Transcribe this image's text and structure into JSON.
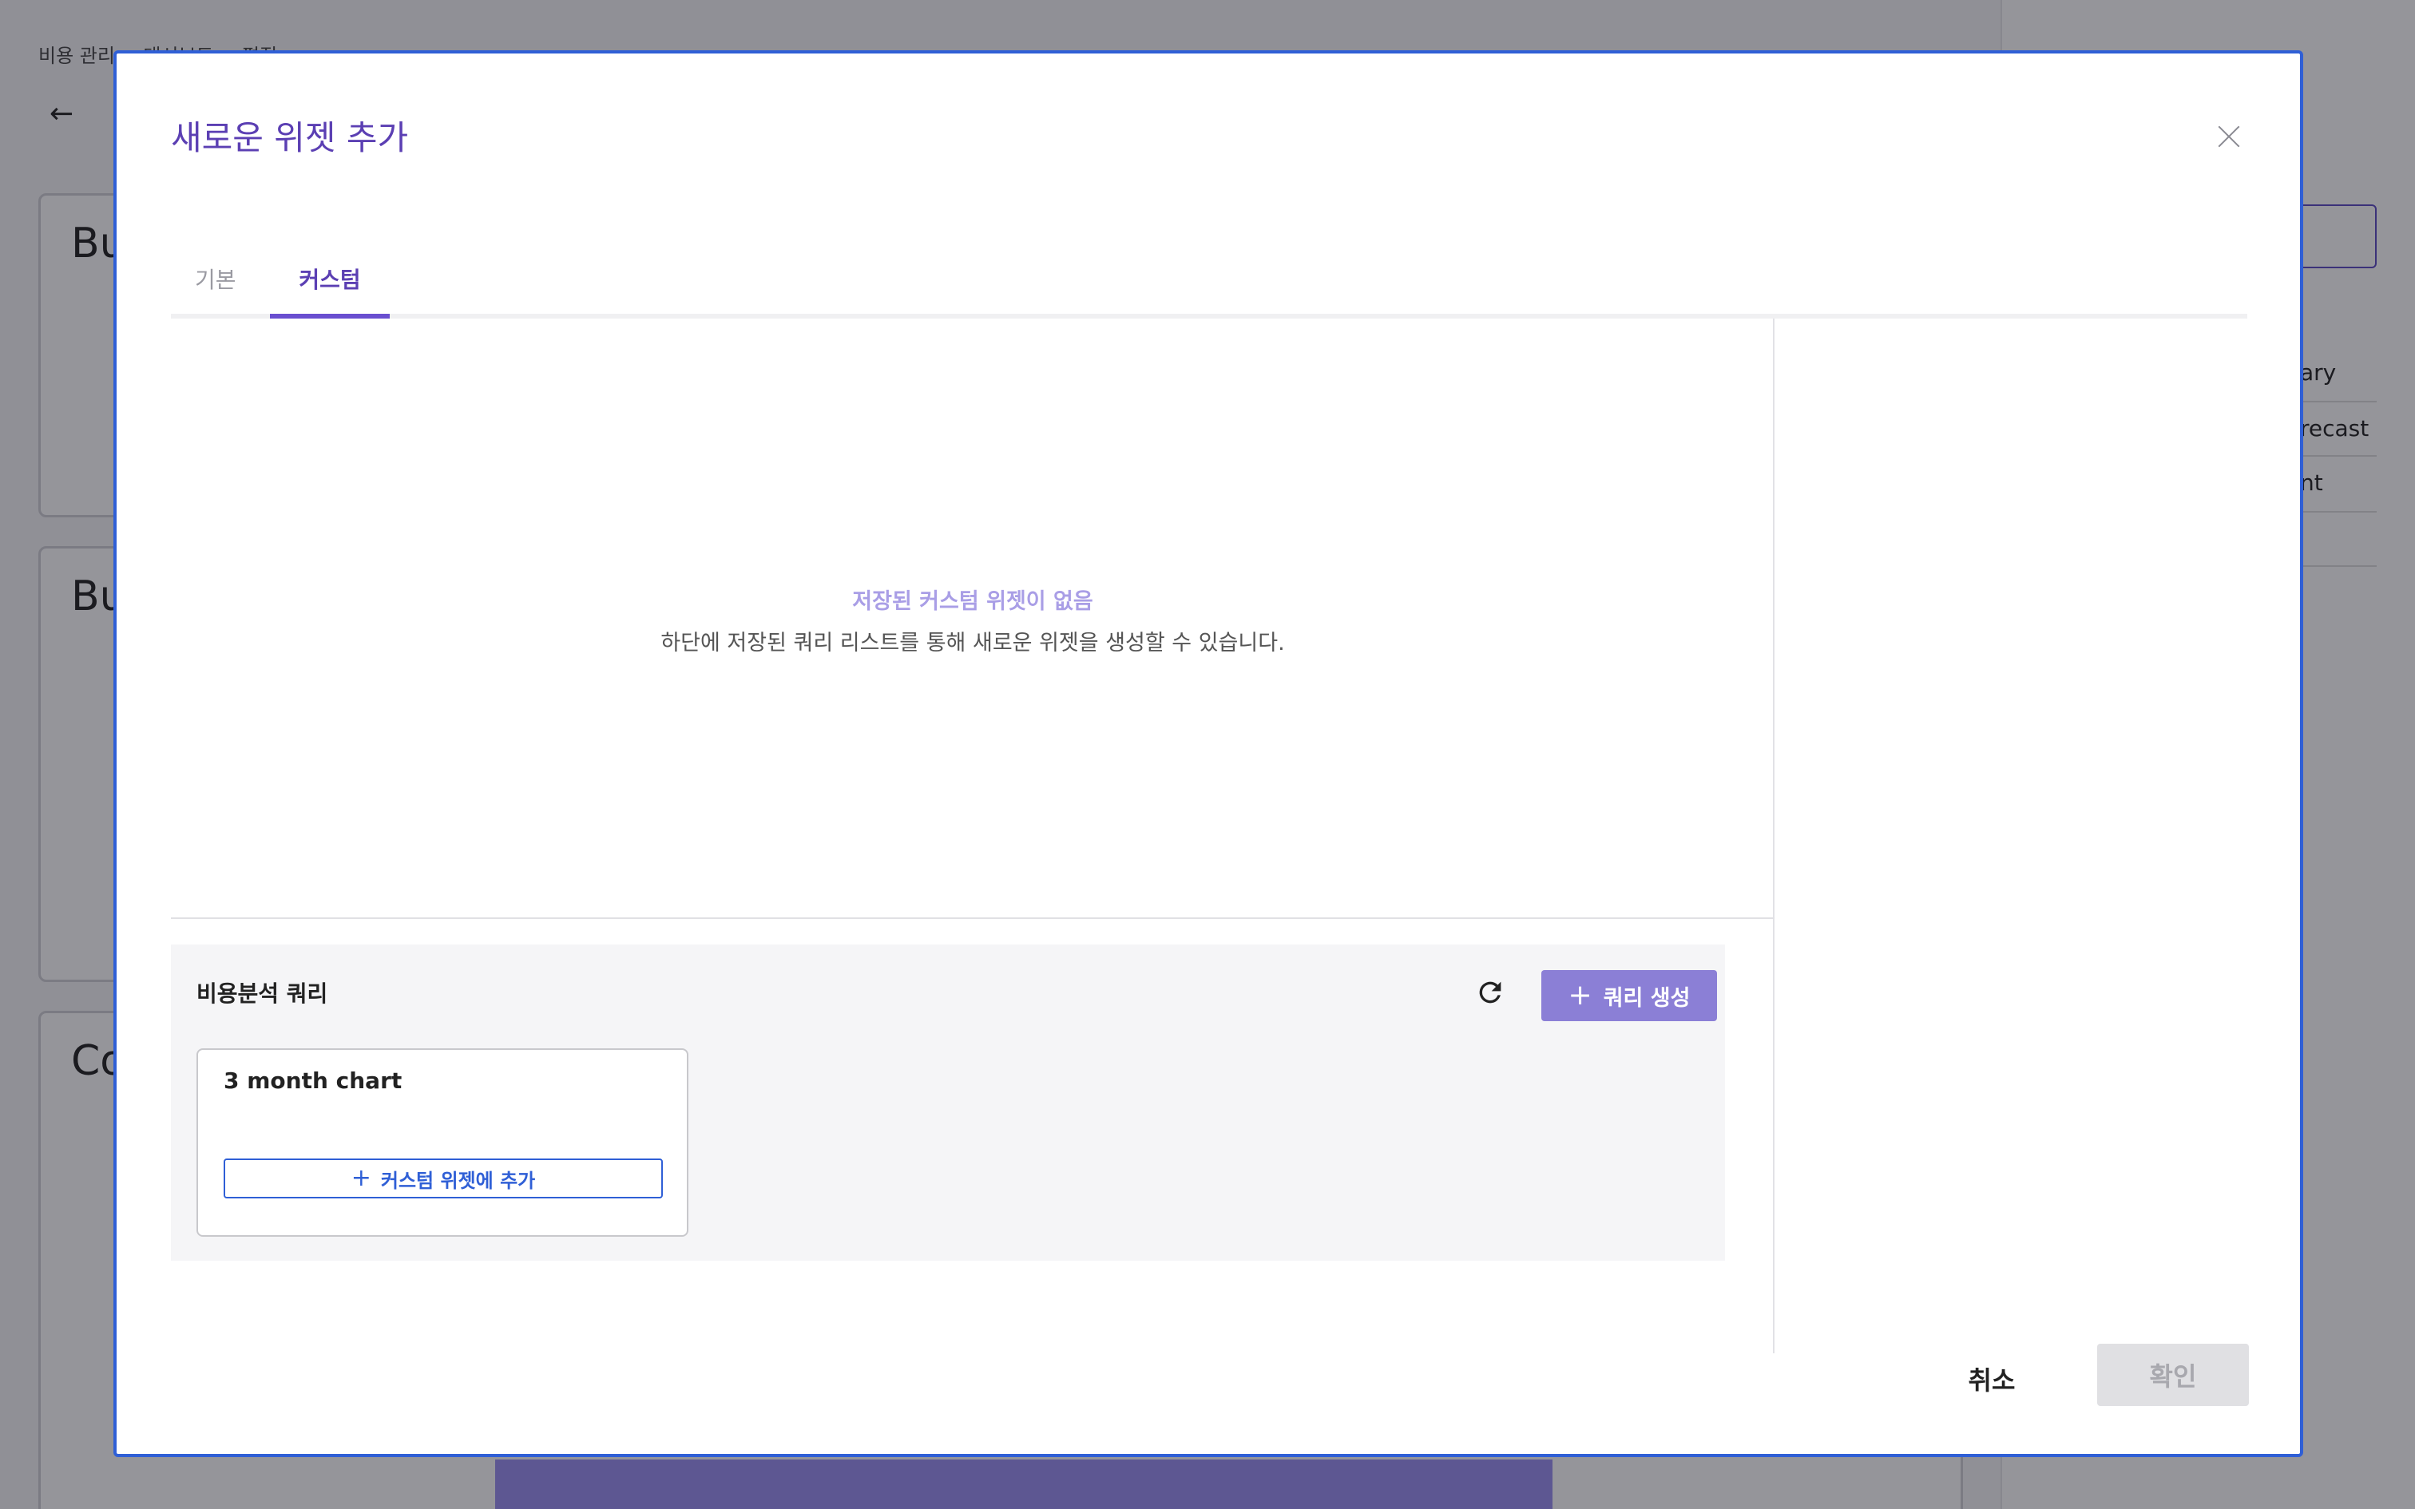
{
  "background": {
    "breadcrumb": "비용 관리 > 대시보드 > 편집",
    "cards": [
      {
        "title": "Bu"
      },
      {
        "title": "Bu"
      },
      {
        "title": "Co"
      }
    ],
    "right_items": [
      "ary",
      "recast",
      "nt"
    ]
  },
  "modal": {
    "title": "새로운 위젯 추가",
    "tabs": [
      {
        "label": "기본"
      },
      {
        "label": "커스텀"
      }
    ],
    "active_tab": "커스텀",
    "empty_state": {
      "title": "저장된 커스텀 위젯이 없음",
      "description": "하단에 저장된 쿼리 리스트를 통해 새로운 위젯을 생성할 수 있습니다."
    },
    "query_section": {
      "title": "비용분석 쿼리",
      "create_button": "쿼리 생성",
      "queries": [
        {
          "name": "3 month chart",
          "add_button": "커스텀 위젯에 추가"
        }
      ]
    },
    "footer": {
      "cancel": "취소",
      "confirm": "확인"
    }
  },
  "colors": {
    "accent": "#6a4fd0",
    "title": "#5b3fb3",
    "create_button": "#8b7fd6",
    "link_blue": "#2f5fd6"
  }
}
